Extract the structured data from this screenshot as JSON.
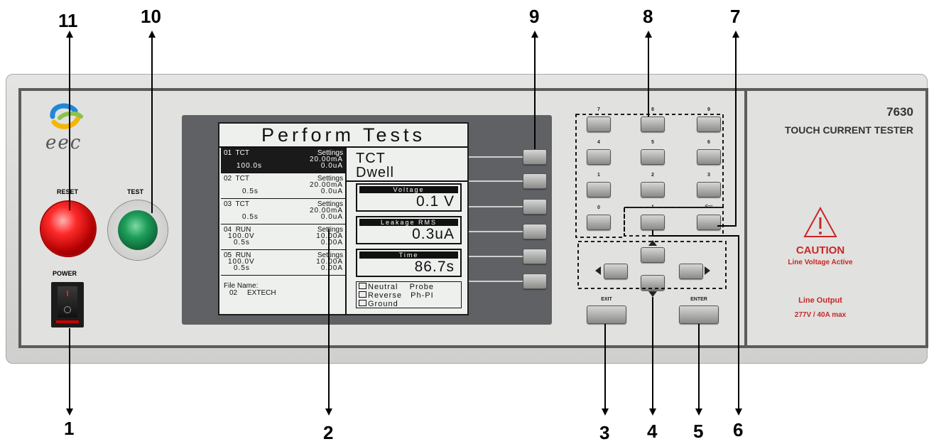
{
  "callouts": [
    "1",
    "2",
    "3",
    "4",
    "5",
    "6",
    "7",
    "8",
    "9",
    "10",
    "11"
  ],
  "brand": {
    "logo_text": "eec"
  },
  "labels": {
    "reset": "RESET",
    "test": "TEST",
    "power": "POWER"
  },
  "screen": {
    "title": "Perform Tests",
    "tests": [
      {
        "num": "01",
        "mode": "TCT",
        "settings": "Settings",
        "line2": "20.00mA",
        "left3": "100.0s",
        "right3": "0.0uA"
      },
      {
        "num": "02",
        "mode": "TCT",
        "settings": "Settings",
        "line2": "20.00mA",
        "left3": "0.5s",
        "right3": "0.0uA"
      },
      {
        "num": "03",
        "mode": "TCT",
        "settings": "Settings",
        "line2": "20.00mA",
        "left3": "0.5s",
        "right3": "0.0uA"
      },
      {
        "num": "04",
        "mode": "RUN",
        "settings": "Settings",
        "left2": "100.0V",
        "line2": "10.00A",
        "left3": "0.5s",
        "right3": "0.00A"
      },
      {
        "num": "05",
        "mode": "RUN",
        "settings": "Settings",
        "left2": "100.0V",
        "line2": "10.00A",
        "left3": "0.5s",
        "right3": "0.00A"
      }
    ],
    "file_label": "File Name:",
    "file_value": "02     EXTECH",
    "mode_line1": "TCT",
    "mode_line2": "Dwell",
    "meas": [
      {
        "header": "Voltage",
        "value": "0.1 V"
      },
      {
        "header": "Leakage RMS",
        "value": "0.3uA"
      },
      {
        "header": "Time",
        "value": "86.7s"
      }
    ],
    "options": [
      "Neutral    Probe",
      "Reverse   Ph-PI",
      "Ground"
    ]
  },
  "keypad": {
    "keys": [
      "7",
      "8",
      "9",
      "4",
      "5",
      "6",
      "1",
      "2",
      "3",
      "0",
      "•",
      "<—"
    ]
  },
  "nav": {
    "exit": "EXIT",
    "enter": "ENTER"
  },
  "model": {
    "number": "7630",
    "name": "TOUCH CURRENT TESTER"
  },
  "caution": {
    "title": "CAUTION",
    "subtitle": "Line Voltage Active",
    "output_label": "Line Output",
    "output_value": "277V / 40A max"
  },
  "colors": {
    "caution_red": "#c62828",
    "reset_lamp": "#e01818",
    "test_lamp": "#1e9e5a",
    "panel": "#e1e1df",
    "bezel": "#5f6165"
  }
}
